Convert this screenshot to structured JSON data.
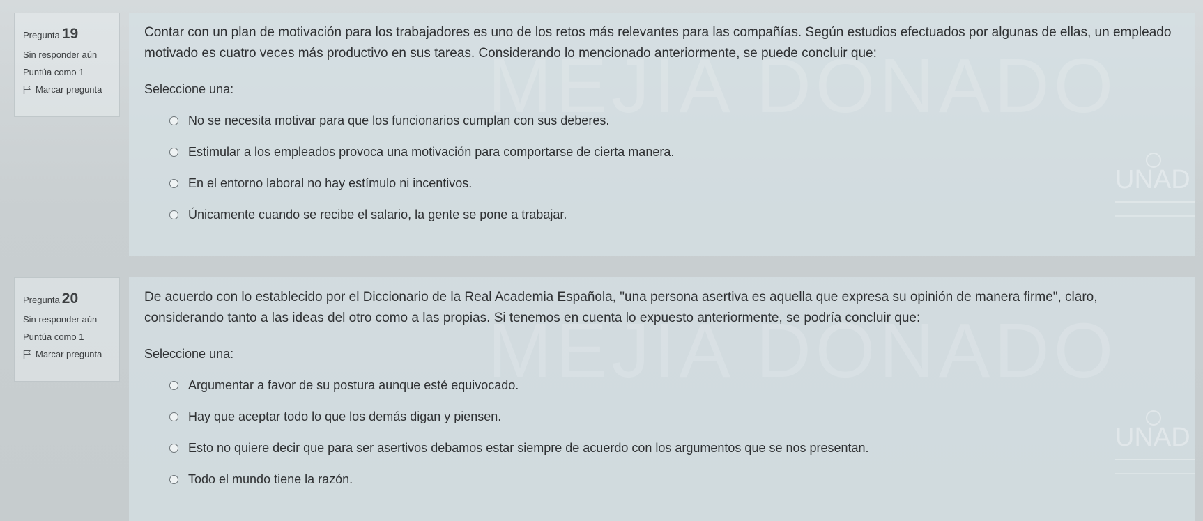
{
  "questions": [
    {
      "label": "Pregunta",
      "number": "19",
      "status": "Sin responder aún",
      "score": "Puntúa como 1",
      "flag_label": "Marcar pregunta",
      "text": "Contar con un plan de motivación para los trabajadores es uno de los retos más relevantes para las compañías. Según estudios efectuados por algunas de ellas, un empleado motivado es cuatro veces más productivo en sus tareas. Considerando lo mencionado anteriormente, se puede concluir que:",
      "prompt": "Seleccione una:",
      "options": [
        "No se necesita motivar para que los funcionarios cumplan con sus deberes.",
        "Estimular a los empleados provoca una motivación para comportarse de cierta manera.",
        "En el entorno laboral no hay estímulo ni incentivos.",
        "Únicamente cuando se recibe el salario, la gente se pone a trabajar."
      ]
    },
    {
      "label": "Pregunta",
      "number": "20",
      "status": "Sin responder aún",
      "score": "Puntúa como 1",
      "flag_label": "Marcar pregunta",
      "text": "De acuerdo con lo establecido por el Diccionario de la Real Academia Española, \"una persona asertiva es aquella que expresa su opinión de manera firme\", claro, considerando tanto a las ideas del otro como a las propias. Si tenemos en cuenta lo expuesto anteriormente, se podría concluir que:",
      "prompt": "Seleccione una:",
      "options": [
        "Argumentar a favor de su postura aunque esté equivocado.",
        "Hay que aceptar todo lo que los demás digan y piensen.",
        "Esto no quiere decir que para ser asertivos debamos estar siempre de acuerdo con los argumentos que se nos presentan.",
        "Todo el mundo tiene la razón."
      ]
    }
  ],
  "watermark_text": "MEJIA DONADO",
  "logo_text": "UNAD",
  "colors": {
    "background": "#c9cfd1",
    "panel": "#d6e1e4",
    "text": "#2f3133"
  }
}
